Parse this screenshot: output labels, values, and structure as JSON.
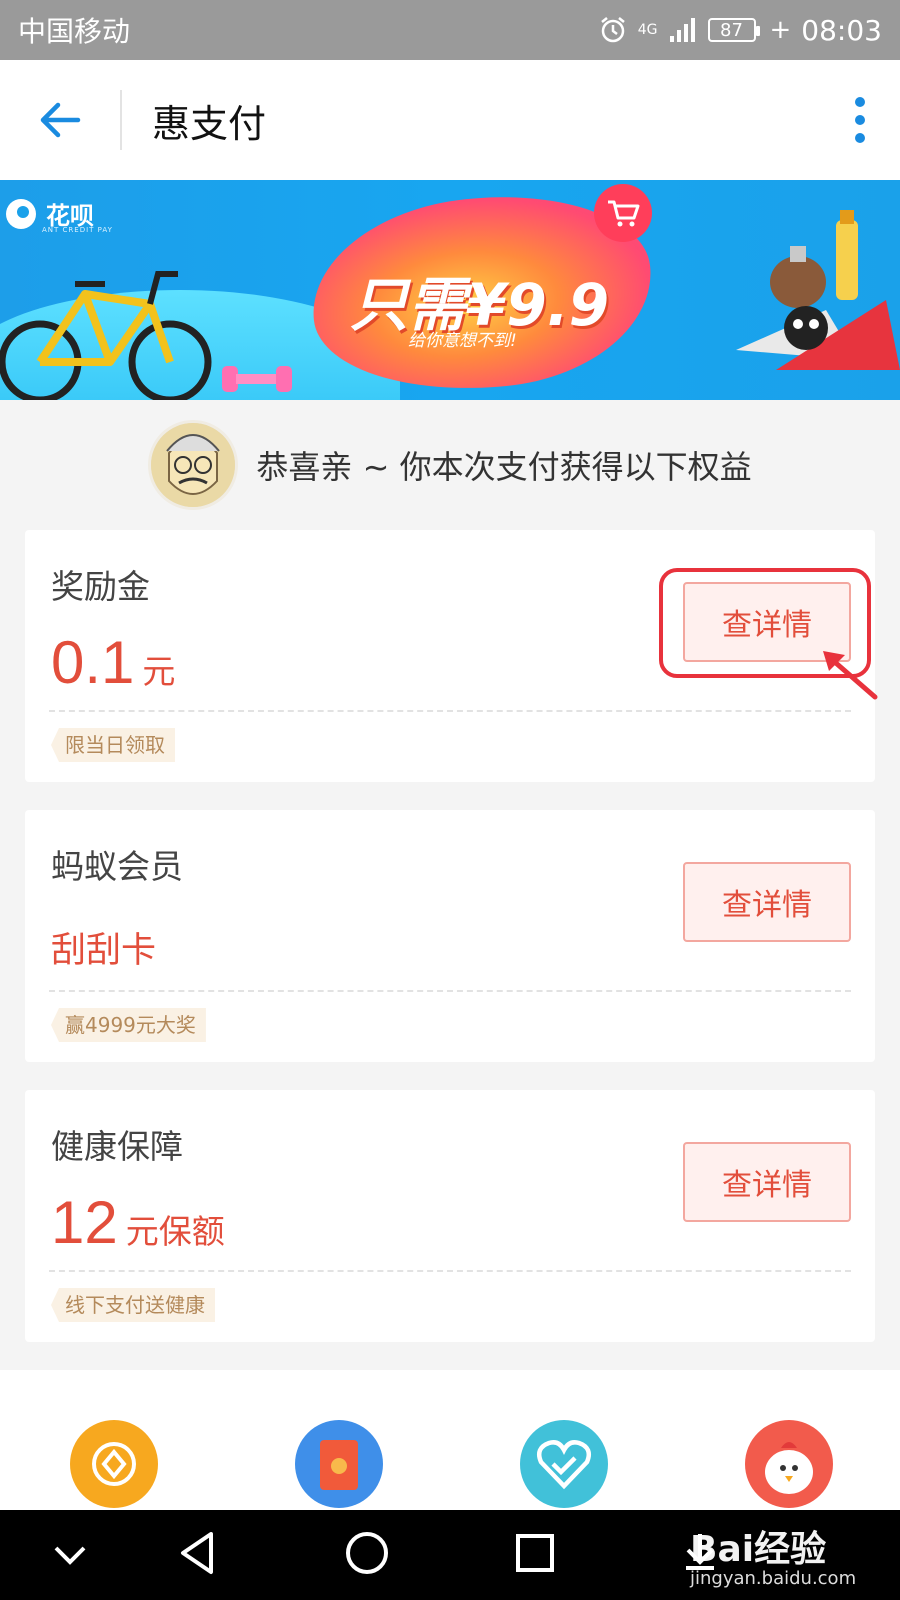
{
  "status_bar": {
    "carrier": "中国移动",
    "network": "4G",
    "battery": "87",
    "time": "08:03"
  },
  "header": {
    "title": "惠支付"
  },
  "banner": {
    "brand": "花呗",
    "brand_sub": "ANT CREDIT PAY",
    "headline": "只需¥9.9",
    "subline": "给你意想不到!"
  },
  "congrats": {
    "text": "恭喜亲 ~ 你本次支付获得以下权益"
  },
  "cards": [
    {
      "title": "奖励金",
      "value": "0.1",
      "unit": "元",
      "tag": "限当日领取",
      "button": "查详情"
    },
    {
      "title": "蚂蚁会员",
      "value": "刮刮卡",
      "unit": "",
      "tag": "赢4999元大奖",
      "button": "查详情"
    },
    {
      "title": "健康保障",
      "value": "12",
      "unit": "元保额",
      "tag": "线下支付送健康",
      "button": "查详情"
    }
  ],
  "watermark": {
    "name": "Bai经验",
    "url": "jingyan.baidu.com"
  },
  "colors": {
    "accent": "#e24e3b",
    "highlight": "#e8323c",
    "banner_bg": "#1aa1ea"
  }
}
